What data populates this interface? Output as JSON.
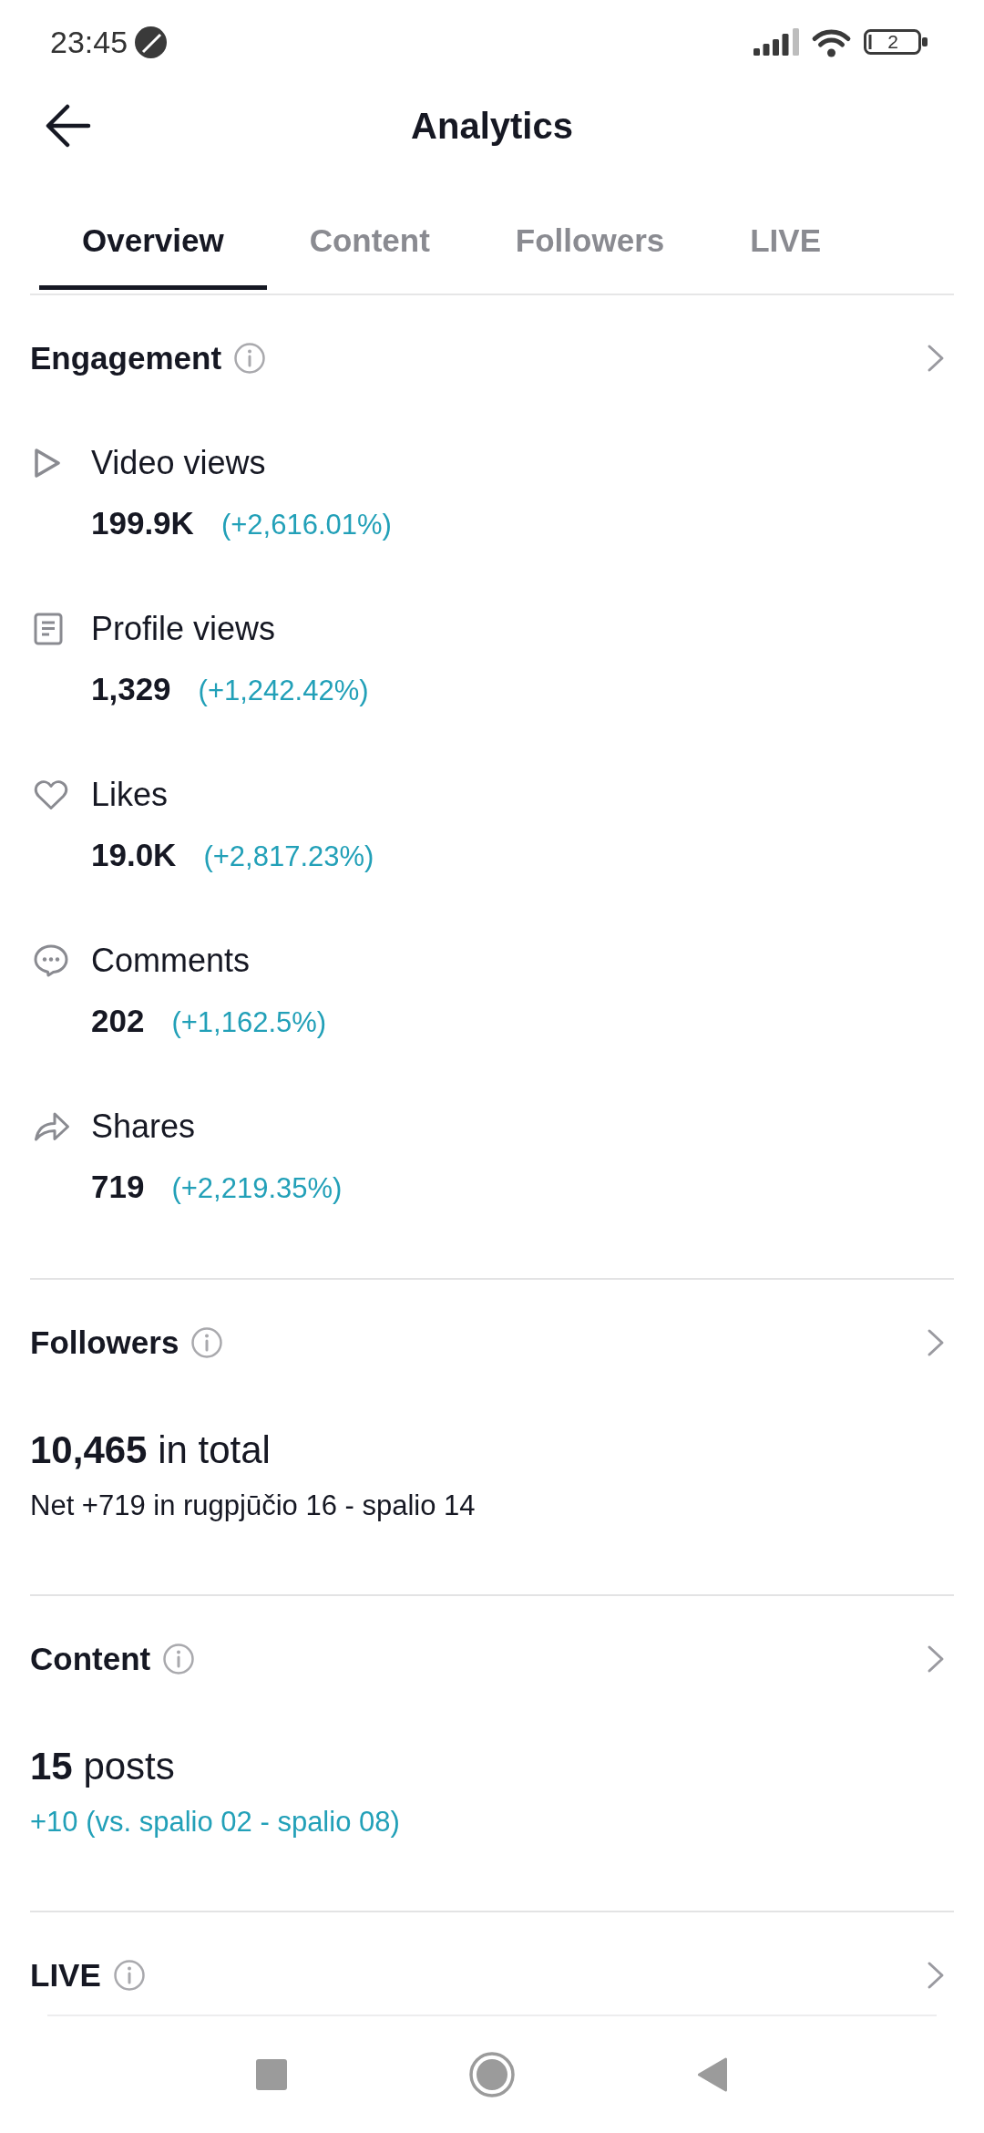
{
  "status_bar": {
    "time": "23:45",
    "battery": "2"
  },
  "header": {
    "title": "Analytics"
  },
  "tabs": [
    {
      "label": "Overview",
      "selected": true
    },
    {
      "label": "Content",
      "selected": false
    },
    {
      "label": "Followers",
      "selected": false
    },
    {
      "label": "LIVE",
      "selected": false
    }
  ],
  "sections": [
    {
      "kind": "metrics",
      "title": "Engagement",
      "metrics": [
        {
          "kind": "views",
          "label": "Video views",
          "value": "199.9K",
          "change": "(+2,616.01%)"
        },
        {
          "kind": "profile",
          "label": "Profile views",
          "value": "1,329",
          "change": "(+1,242.42%)"
        },
        {
          "kind": "likes",
          "label": "Likes",
          "value": "19.0K",
          "change": "(+2,817.23%)"
        },
        {
          "kind": "comments",
          "label": "Comments",
          "value": "202",
          "change": "(+1,162.5%)"
        },
        {
          "kind": "shares",
          "label": "Shares",
          "value": "719",
          "change": "(+2,219.35%)"
        }
      ]
    },
    {
      "kind": "total",
      "title": "Followers",
      "total": "**10,465** in total",
      "detail": "Net +719 in rugpjūčio 16 - spalio 14",
      "detail_highlighted": false
    },
    {
      "kind": "total",
      "title": "Content",
      "total": "**15** posts",
      "detail": "+10 (vs. spalio 02 - spalio 08)",
      "detail_highlighted": true
    },
    {
      "kind": "header",
      "title": "LIVE"
    }
  ]
}
